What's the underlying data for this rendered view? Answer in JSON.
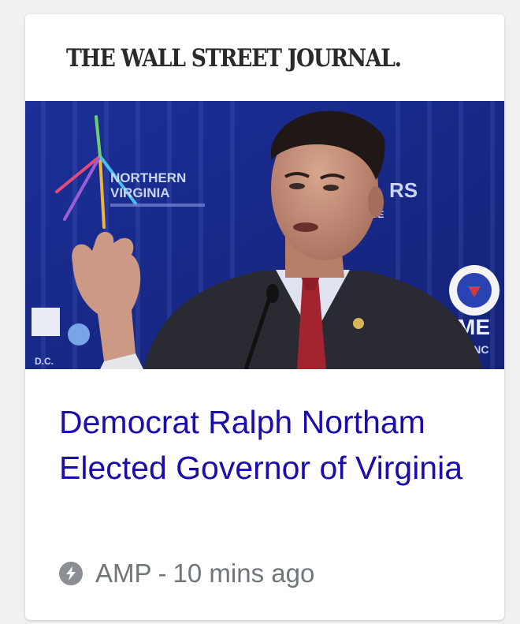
{
  "publisher": {
    "name": "THE WALL STREET JOURNAL."
  },
  "thumbnail": {
    "backdrop_sign_left": [
      "NORTHERN",
      "VIRGINIA"
    ],
    "backdrop_sign_right": "RS",
    "backdrop_sign_right2": "ME",
    "backdrop_sign_right3": "RANC",
    "backdrop_small": "NCE",
    "backdrop_logo_small": "D.C."
  },
  "article": {
    "headline": "Democrat Ralph Northam Elected Governor of Virginia",
    "source": "AMP",
    "separator": "-",
    "time": "10 mins ago"
  },
  "colors": {
    "headline": "#1a0dab",
    "meta": "#70757a",
    "backdrop": "#1d2d8f"
  }
}
